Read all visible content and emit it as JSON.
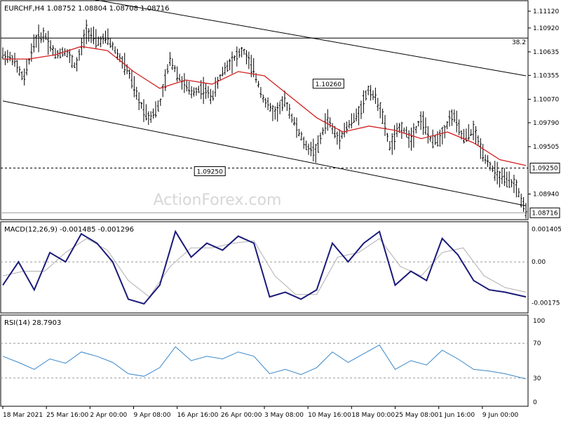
{
  "chart_data": [
    {
      "type": "candlestick",
      "panel": "price",
      "header": "EURCHF,H4  1.08752 1.08804 1.08708 1.08716",
      "y_ticks": [
        "1.11120",
        "1.10920",
        "1.10635",
        "1.10355",
        "1.10070",
        "1.09790",
        "1.09505",
        "1.08940"
      ],
      "ylim": [
        1.0866,
        1.1122
      ],
      "fib_label": "38.2",
      "fib_level": 1.108,
      "support_level": 1.0925,
      "support_label": "1.09250",
      "current_price_label": "1.08716",
      "current_price": 1.08716,
      "annotations": [
        {
          "text": "1.10260",
          "x": 0.66,
          "y": 1.1026
        },
        {
          "text": "1.09250",
          "x": 0.57,
          "y": 1.0925
        }
      ],
      "channel_upper": [
        {
          "x": 0.0,
          "y": 1.1145
        },
        {
          "x": 1.0,
          "y": 1.1035
        }
      ],
      "channel_lower": [
        {
          "x": 0.0,
          "y": 1.1005
        },
        {
          "x": 1.0,
          "y": 1.088
        }
      ],
      "series": [
        {
          "name": "price",
          "color": "#000000",
          "points": [
            [
              0.0,
              1.106
            ],
            [
              0.02,
              1.1055
            ],
            [
              0.04,
              1.103
            ],
            [
              0.06,
              1.1075
            ],
            [
              0.08,
              1.1085
            ],
            [
              0.1,
              1.106
            ],
            [
              0.12,
              1.1065
            ],
            [
              0.14,
              1.1045
            ],
            [
              0.16,
              1.109
            ],
            [
              0.18,
              1.1075
            ],
            [
              0.2,
              1.108
            ],
            [
              0.22,
              1.106
            ],
            [
              0.24,
              1.104
            ],
            [
              0.26,
              1.1005
            ],
            [
              0.28,
              1.0985
            ],
            [
              0.3,
              1.1
            ],
            [
              0.32,
              1.1055
            ],
            [
              0.34,
              1.103
            ],
            [
              0.36,
              1.1015
            ],
            [
              0.38,
              1.102
            ],
            [
              0.4,
              1.101
            ],
            [
              0.42,
              1.104
            ],
            [
              0.44,
              1.1055
            ],
            [
              0.46,
              1.1065
            ],
            [
              0.48,
              1.104
            ],
            [
              0.5,
              1.1005
            ],
            [
              0.52,
              1.099
            ],
            [
              0.54,
              1.1005
            ],
            [
              0.56,
              1.0975
            ],
            [
              0.58,
              1.095
            ],
            [
              0.6,
              1.0945
            ],
            [
              0.62,
              1.0985
            ],
            [
              0.64,
              1.096
            ],
            [
              0.66,
              1.0975
            ],
            [
              0.68,
              1.099
            ],
            [
              0.7,
              1.102
            ],
            [
              0.72,
              1.1
            ],
            [
              0.74,
              1.095
            ],
            [
              0.76,
              1.0975
            ],
            [
              0.78,
              1.096
            ],
            [
              0.8,
              1.0985
            ],
            [
              0.82,
              1.0955
            ],
            [
              0.84,
              1.0965
            ],
            [
              0.86,
              1.099
            ],
            [
              0.88,
              1.096
            ],
            [
              0.9,
              1.097
            ],
            [
              0.92,
              1.094
            ],
            [
              0.94,
              1.092
            ],
            [
              0.96,
              1.091
            ],
            [
              0.98,
              1.0905
            ],
            [
              1.0,
              1.0872
            ]
          ]
        },
        {
          "name": "moving-average",
          "color": "#d22020",
          "points": [
            [
              0.0,
              1.1055
            ],
            [
              0.05,
              1.1055
            ],
            [
              0.1,
              1.106
            ],
            [
              0.15,
              1.107
            ],
            [
              0.2,
              1.1065
            ],
            [
              0.25,
              1.104
            ],
            [
              0.3,
              1.102
            ],
            [
              0.35,
              1.103
            ],
            [
              0.4,
              1.1025
            ],
            [
              0.45,
              1.104
            ],
            [
              0.5,
              1.1035
            ],
            [
              0.55,
              1.101
            ],
            [
              0.6,
              1.0985
            ],
            [
              0.65,
              1.0968
            ],
            [
              0.7,
              1.0975
            ],
            [
              0.75,
              1.097
            ],
            [
              0.8,
              1.096
            ],
            [
              0.85,
              1.0968
            ],
            [
              0.9,
              1.0955
            ],
            [
              0.95,
              1.0935
            ],
            [
              1.0,
              1.0928
            ]
          ]
        }
      ]
    },
    {
      "type": "line",
      "panel": "macd",
      "header": "MACD(12,26,9) -0.001485 -0.001296",
      "y_ticks": [
        "0.001405",
        "0.00",
        "-0.00175"
      ],
      "zero_label": "0.00",
      "ylim": [
        -0.0021,
        0.0016
      ],
      "series": [
        {
          "name": "macd",
          "color": "#1a1a7a",
          "points": [
            [
              0.0,
              -0.001
            ],
            [
              0.03,
              0.0
            ],
            [
              0.06,
              -0.0012
            ],
            [
              0.09,
              0.0004
            ],
            [
              0.12,
              0.0
            ],
            [
              0.15,
              0.0012
            ],
            [
              0.18,
              0.0008
            ],
            [
              0.21,
              0.0
            ],
            [
              0.24,
              -0.0016
            ],
            [
              0.27,
              -0.0018
            ],
            [
              0.3,
              -0.001
            ],
            [
              0.33,
              0.0013
            ],
            [
              0.36,
              0.0002
            ],
            [
              0.39,
              0.0008
            ],
            [
              0.42,
              0.0005
            ],
            [
              0.45,
              0.0011
            ],
            [
              0.48,
              0.0008
            ],
            [
              0.51,
              -0.0015
            ],
            [
              0.54,
              -0.0013
            ],
            [
              0.57,
              -0.0016
            ],
            [
              0.6,
              -0.0012
            ],
            [
              0.63,
              0.0008
            ],
            [
              0.66,
              0.0
            ],
            [
              0.69,
              0.0008
            ],
            [
              0.72,
              0.0013
            ],
            [
              0.75,
              -0.001
            ],
            [
              0.78,
              -0.0004
            ],
            [
              0.81,
              -0.0008
            ],
            [
              0.84,
              0.001
            ],
            [
              0.87,
              0.0003
            ],
            [
              0.9,
              -0.0008
            ],
            [
              0.93,
              -0.0012
            ],
            [
              0.96,
              -0.0013
            ],
            [
              1.0,
              -0.0015
            ]
          ]
        },
        {
          "name": "signal",
          "color": "#b0b0b0",
          "points": [
            [
              0.0,
              -0.0006
            ],
            [
              0.04,
              -0.0004
            ],
            [
              0.08,
              -0.0004
            ],
            [
              0.12,
              0.0004
            ],
            [
              0.16,
              0.001
            ],
            [
              0.2,
              0.0005
            ],
            [
              0.24,
              -0.0008
            ],
            [
              0.28,
              -0.0015
            ],
            [
              0.32,
              -0.0002
            ],
            [
              0.36,
              0.0006
            ],
            [
              0.4,
              0.0006
            ],
            [
              0.44,
              0.0008
            ],
            [
              0.48,
              0.0009
            ],
            [
              0.52,
              -0.0006
            ],
            [
              0.56,
              -0.0014
            ],
            [
              0.6,
              -0.0014
            ],
            [
              0.64,
              0.0002
            ],
            [
              0.68,
              0.0004
            ],
            [
              0.72,
              0.001
            ],
            [
              0.76,
              -0.0002
            ],
            [
              0.8,
              -0.0006
            ],
            [
              0.84,
              0.0004
            ],
            [
              0.88,
              0.0006
            ],
            [
              0.92,
              -0.0006
            ],
            [
              0.96,
              -0.0011
            ],
            [
              1.0,
              -0.0013
            ]
          ]
        }
      ]
    },
    {
      "type": "line",
      "panel": "rsi",
      "header": "RSI(14) 28.7903",
      "y_ticks": [
        "100",
        "70",
        "30",
        "0"
      ],
      "ylim": [
        0,
        100
      ],
      "levels": [
        70,
        30
      ],
      "series": [
        {
          "name": "rsi",
          "color": "#3a87c8",
          "points": [
            [
              0.0,
              55
            ],
            [
              0.03,
              48
            ],
            [
              0.06,
              40
            ],
            [
              0.09,
              52
            ],
            [
              0.12,
              47
            ],
            [
              0.15,
              60
            ],
            [
              0.18,
              55
            ],
            [
              0.21,
              48
            ],
            [
              0.24,
              35
            ],
            [
              0.27,
              32
            ],
            [
              0.3,
              42
            ],
            [
              0.33,
              66
            ],
            [
              0.36,
              50
            ],
            [
              0.39,
              55
            ],
            [
              0.42,
              52
            ],
            [
              0.45,
              60
            ],
            [
              0.48,
              55
            ],
            [
              0.51,
              35
            ],
            [
              0.54,
              40
            ],
            [
              0.57,
              34
            ],
            [
              0.6,
              42
            ],
            [
              0.63,
              60
            ],
            [
              0.66,
              48
            ],
            [
              0.69,
              58
            ],
            [
              0.72,
              68
            ],
            [
              0.75,
              40
            ],
            [
              0.78,
              50
            ],
            [
              0.81,
              45
            ],
            [
              0.84,
              62
            ],
            [
              0.87,
              52
            ],
            [
              0.9,
              40
            ],
            [
              0.93,
              38
            ],
            [
              0.96,
              35
            ],
            [
              1.0,
              29
            ]
          ]
        }
      ]
    }
  ],
  "x_axis": {
    "tick_labels": [
      "18 Mar 2021",
      "25 Mar 16:00",
      "2 Apr 00:00",
      "9 Apr 08:00",
      "16 Apr 16:00",
      "26 Apr 00:00",
      "3 May 08:00",
      "10 May 16:00",
      "18 May 00:00",
      "25 May 08:00",
      "1 Jun 16:00",
      "9 Jun 00:00"
    ]
  },
  "watermark": "ActionForex.com"
}
